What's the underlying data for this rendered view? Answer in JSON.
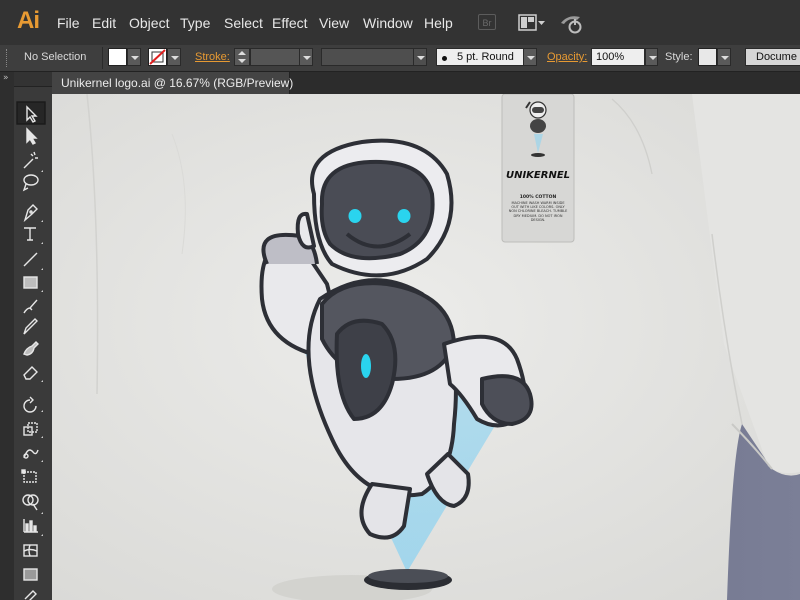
{
  "app": {
    "logo": "Ai",
    "menus": [
      "File",
      "Edit",
      "Object",
      "Type",
      "Select",
      "Effect",
      "View",
      "Window",
      "Help"
    ],
    "bridge_label": "Br"
  },
  "control_bar": {
    "selection": "No Selection",
    "stroke_label": "Stroke:",
    "brush": "5 pt. Round",
    "opacity_label": "Opacity:",
    "opacity": "100%",
    "style_label": "Style:",
    "document_button": "Docume"
  },
  "document_tab": {
    "title": "Unikernel logo.ai @ 16.67% (RGB/Preview)"
  },
  "artwork": {
    "tag_brand": "UNIKERNEL",
    "tag_material": "100% COTTON",
    "tag_care_text": "MACHINE WASH WARM INSIDE OUT WITH LIKE COLORS. ONLY NON CHLORINE BLEACH. TUMBLE DRY MEDIUM. DO NOT IRON DESIGN."
  },
  "colors": {
    "accent": "#e79a33",
    "menubar": "#333333",
    "panel": "#3a3a3a",
    "shirt": "#e6e6e4",
    "robot_eye": "#2ad4ee",
    "hologram": "#8fd3f0"
  }
}
